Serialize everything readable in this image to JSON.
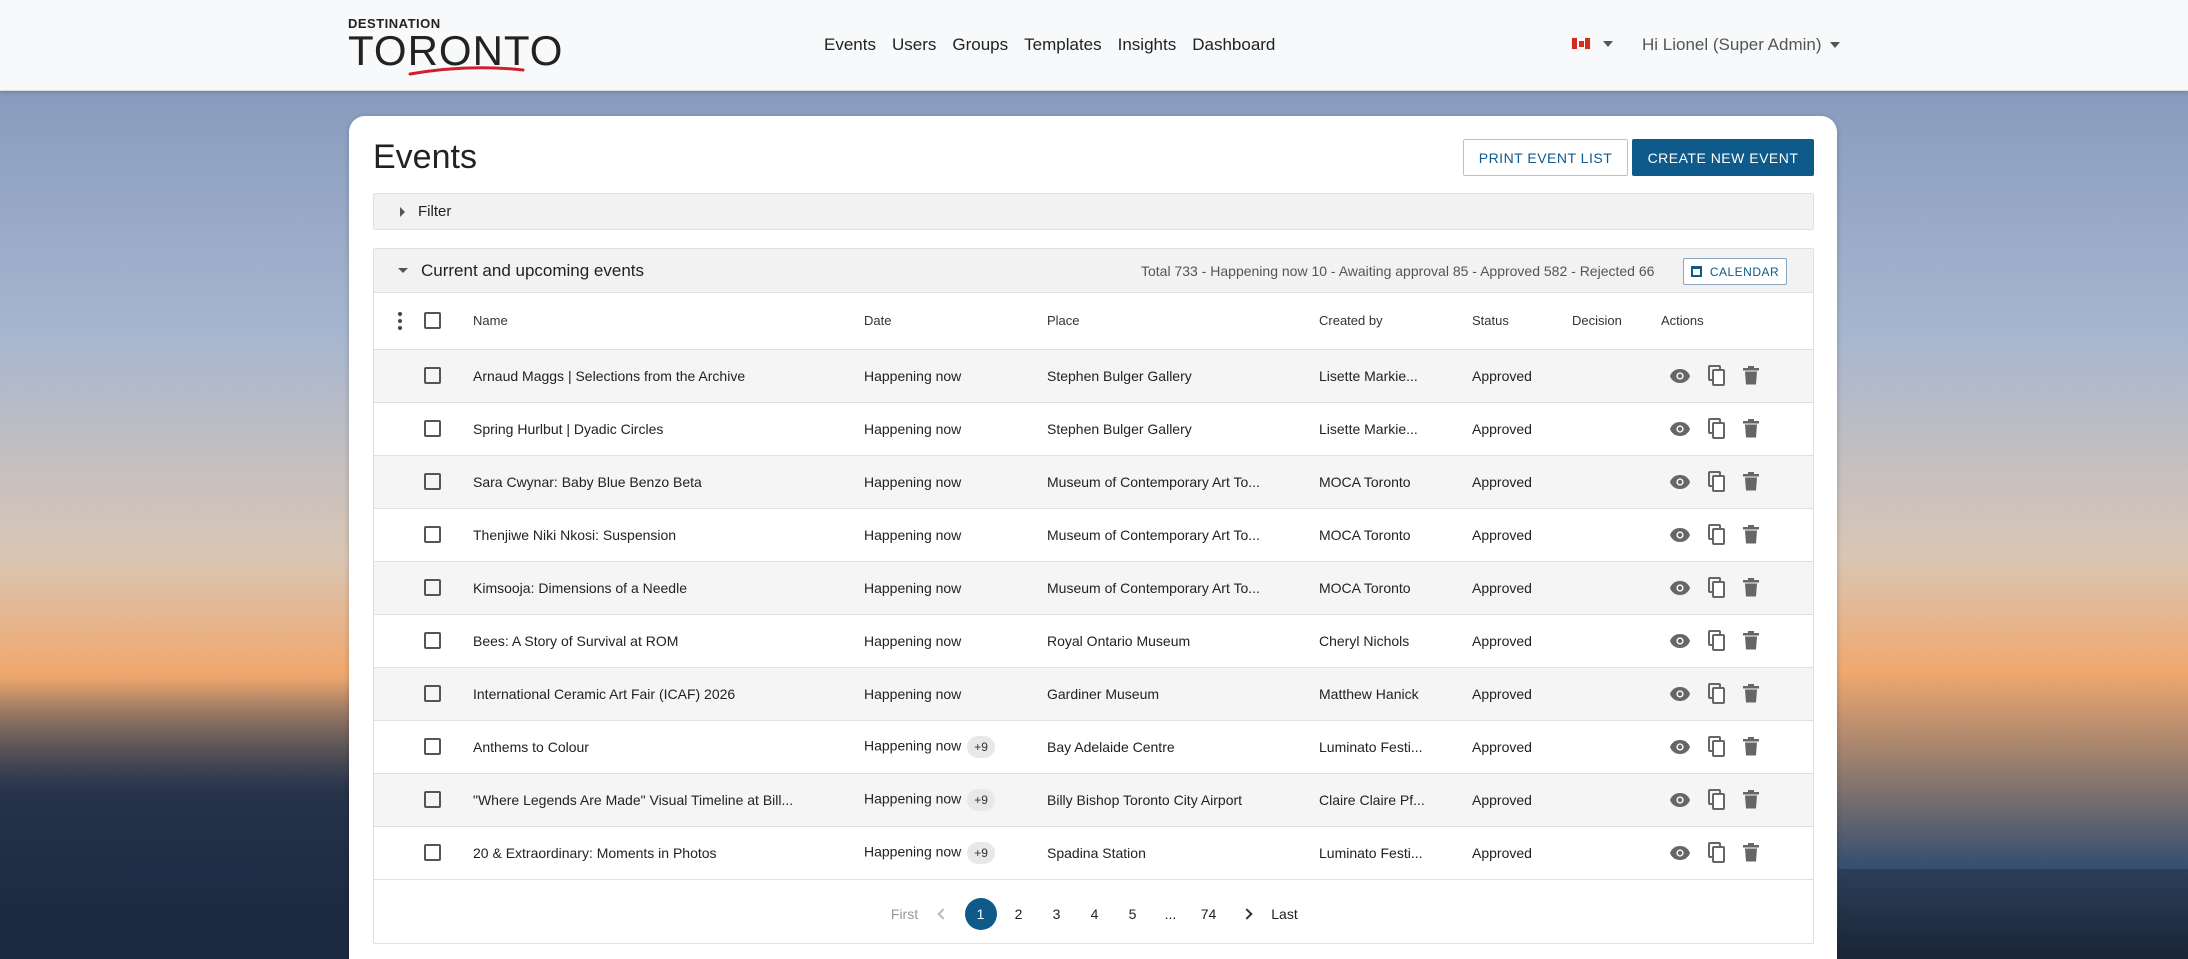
{
  "header": {
    "logo_top": "DESTINATION",
    "logo_main": "TORONTO",
    "nav": [
      "Events",
      "Users",
      "Groups",
      "Templates",
      "Insights",
      "Dashboard"
    ],
    "language_flag": "canada-flag-icon",
    "user_menu": "Hi Lionel (Super Admin)"
  },
  "page": {
    "title": "Events",
    "print_button": "PRINT EVENT LIST",
    "create_button": "CREATE NEW EVENT",
    "filter_label": "Filter"
  },
  "events_panel": {
    "title": "Current and upcoming events",
    "totals": "Total 733 - Happening now 10 - Awaiting approval 85 - Approved 582 - Rejected 66",
    "calendar_button": "CALENDAR",
    "columns": [
      "Name",
      "Date",
      "Place",
      "Created by",
      "Status",
      "Decision",
      "Actions"
    ],
    "rows": [
      {
        "name": "Arnaud Maggs | Selections from the Archive",
        "date": "Happening now",
        "extra": "",
        "place": "Stephen Bulger Gallery",
        "created_by": "Lisette Markie...",
        "status": "Approved",
        "decision": ""
      },
      {
        "name": "Spring Hurlbut | Dyadic Circles",
        "date": "Happening now",
        "extra": "",
        "place": "Stephen Bulger Gallery",
        "created_by": "Lisette Markie...",
        "status": "Approved",
        "decision": ""
      },
      {
        "name": "Sara Cwynar: Baby Blue Benzo Beta",
        "date": "Happening now",
        "extra": "",
        "place": "Museum of Contemporary Art To...",
        "created_by": "MOCA Toronto",
        "status": "Approved",
        "decision": ""
      },
      {
        "name": "Thenjiwe Niki Nkosi: Suspension",
        "date": "Happening now",
        "extra": "",
        "place": "Museum of Contemporary Art To...",
        "created_by": "MOCA Toronto",
        "status": "Approved",
        "decision": ""
      },
      {
        "name": "Kimsooja: Dimensions of a Needle",
        "date": "Happening now",
        "extra": "",
        "place": "Museum of Contemporary Art To...",
        "created_by": "MOCA Toronto",
        "status": "Approved",
        "decision": ""
      },
      {
        "name": "Bees: A Story of Survival at ROM",
        "date": "Happening now",
        "extra": "",
        "place": "Royal Ontario Museum",
        "created_by": "Cheryl Nichols",
        "status": "Approved",
        "decision": ""
      },
      {
        "name": "International Ceramic Art Fair (ICAF) 2026",
        "date": "Happening now",
        "extra": "",
        "place": "Gardiner Museum",
        "created_by": "Matthew Hanick",
        "status": "Approved",
        "decision": ""
      },
      {
        "name": "Anthems to Colour",
        "date": "Happening now",
        "extra": "+9",
        "place": "Bay Adelaide Centre",
        "created_by": "Luminato Festi...",
        "status": "Approved",
        "decision": ""
      },
      {
        "name": "\"Where Legends Are Made\" Visual Timeline at Bill...",
        "date": "Happening now",
        "extra": "+9",
        "place": "Billy Bishop Toronto City Airport",
        "created_by": "Claire Claire Pf...",
        "status": "Approved",
        "decision": ""
      },
      {
        "name": "20 & Extraordinary: Moments in Photos",
        "date": "Happening now",
        "extra": "+9",
        "place": "Spadina Station",
        "created_by": "Luminato Festi...",
        "status": "Approved",
        "decision": ""
      }
    ]
  },
  "pagination": {
    "first": "First",
    "pages": [
      "1",
      "2",
      "3",
      "4",
      "5"
    ],
    "ellipsis": "...",
    "last_page": "74",
    "last": "Last",
    "current": "1"
  },
  "colors": {
    "primary": "#0e5a8a",
    "row_alt": "#f5f5f5",
    "panel_header": "#f2f2f2"
  }
}
